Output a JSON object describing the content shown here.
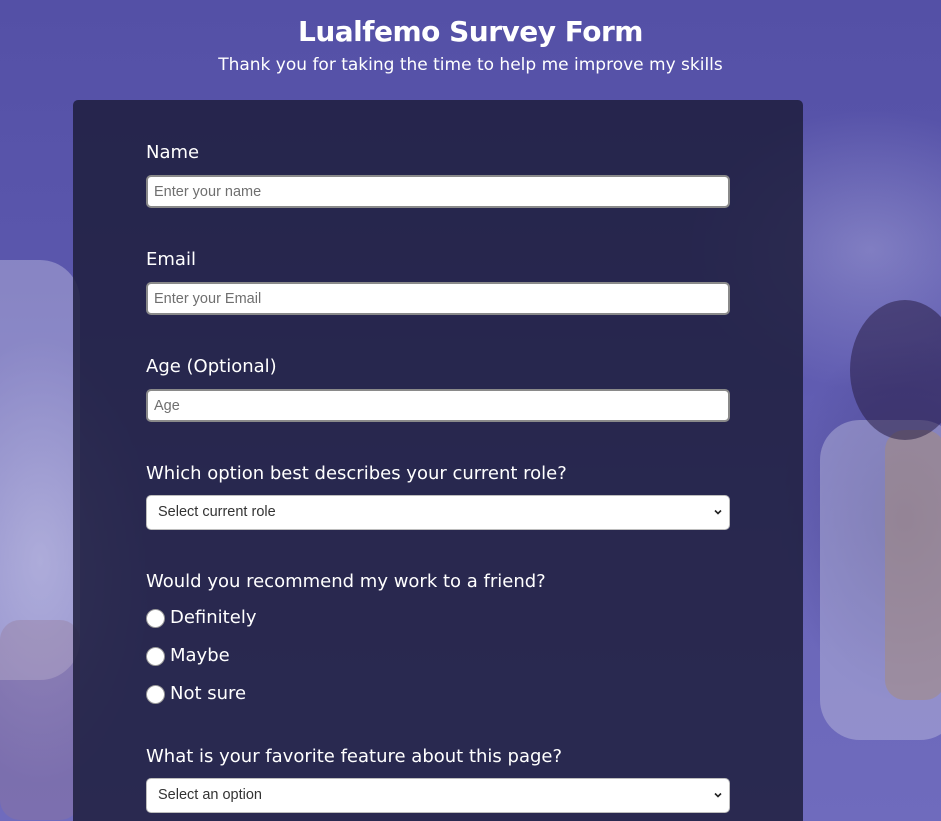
{
  "header": {
    "title": "Lualfemo Survey Form",
    "subtitle": "Thank you for taking the time to help me improve my skills"
  },
  "form": {
    "name": {
      "label": "Name",
      "placeholder": "Enter your name",
      "value": ""
    },
    "email": {
      "label": "Email",
      "placeholder": "Enter your Email",
      "value": ""
    },
    "age": {
      "label": "Age (Optional)",
      "placeholder": "Age",
      "value": ""
    },
    "role": {
      "label": "Which option best describes your current role?",
      "selected": "Select current role",
      "icon": "chevron-down-icon"
    },
    "recommend": {
      "label": "Would you recommend my work to a friend?",
      "options": [
        "Definitely",
        "Maybe",
        "Not sure"
      ],
      "selected": null
    },
    "feature": {
      "label": "What is your favorite feature about this page?",
      "selected": "Select an option",
      "icon": "chevron-down-icon"
    }
  },
  "colors": {
    "background": "#5552a3",
    "card": "#1e1e3e",
    "text": "#ffffff"
  }
}
